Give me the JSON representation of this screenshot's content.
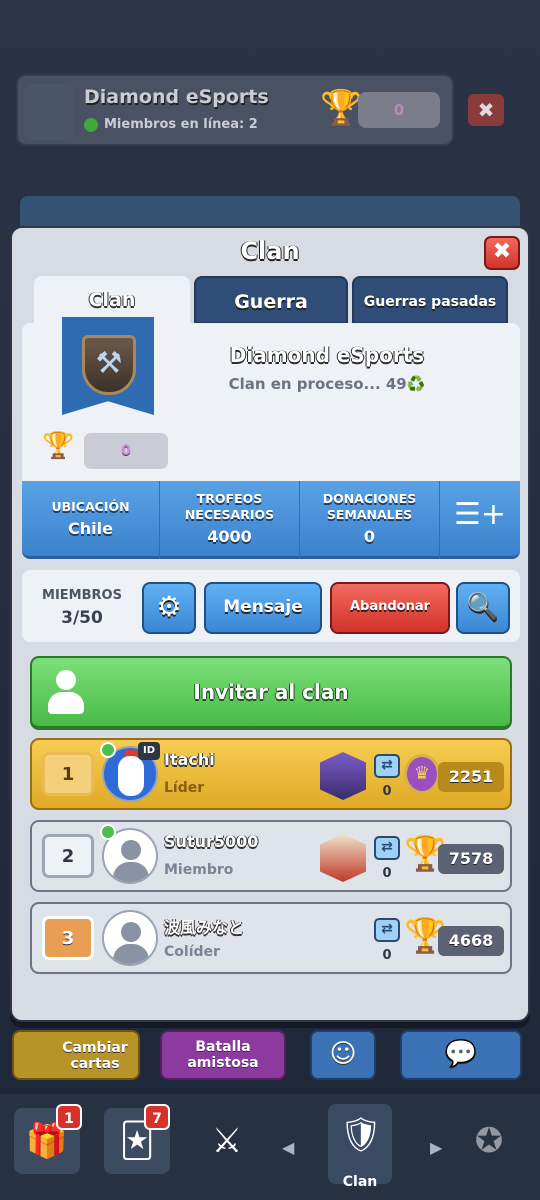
{
  "background": {
    "clan_name": "Diamond eSports",
    "online_label": "Miembros en línea: 2",
    "trophies": "0"
  },
  "modal": {
    "title": "Clan",
    "tabs": [
      {
        "label": "Clan",
        "active": true
      },
      {
        "label": "Guerra",
        "active": false
      },
      {
        "label": "Guerras pasadas",
        "active": false
      }
    ],
    "clan": {
      "name": "Diamond eSports",
      "description": "Clan en proceso... 49♻️",
      "trophies": "0"
    },
    "stats": {
      "location_label": "UBICACIÓN",
      "location_value": "Chile",
      "required_label_1": "TROFEOS",
      "required_label_2": "NECESARIOS",
      "required_value": "4000",
      "donations_label_1": "DONACIONES",
      "donations_label_2": "SEMANALES",
      "donations_value": "0"
    },
    "members": {
      "label": "MIEMBROS",
      "count": "3/50",
      "message_label": "Mensaje",
      "leave_label": "Abandonar"
    },
    "invite_label": "Invitar al clan",
    "rows": [
      {
        "rank": "1",
        "name": "Itachi",
        "role": "Líder",
        "donations": "0",
        "trophies": "2251",
        "online": true,
        "id_tag": "ID"
      },
      {
        "rank": "2",
        "name": "Sutur5000",
        "role": "Miembro",
        "donations": "0",
        "trophies": "7578",
        "online": true
      },
      {
        "rank": "3",
        "name": "波風みなと",
        "role": "Colíder",
        "donations": "0",
        "trophies": "4668",
        "online": false
      }
    ]
  },
  "bottom": {
    "change_cards": "Cambiar cartas",
    "friendly_battle": "Batalla amistosa"
  },
  "nav": {
    "chest_badge": "1",
    "cards_badge": "7",
    "active_label": "Clan"
  },
  "colors": {
    "stats_blue": "#3b82cc",
    "invite_green": "#49bb46",
    "leave_red": "#d2322a",
    "leader_gold": "#e0aa26"
  }
}
